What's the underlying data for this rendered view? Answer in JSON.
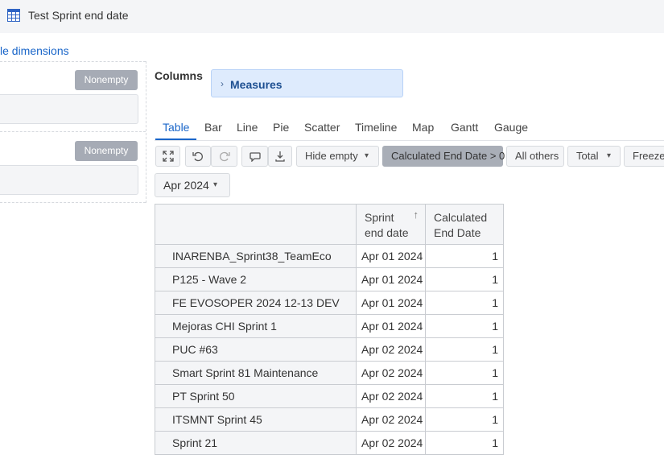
{
  "window": {
    "title": "Test Sprint end date",
    "icon": "table-icon"
  },
  "dimensions_link": "le dimensions",
  "filters": {
    "rows_nonempty": "Nonempty",
    "pages_nonempty": "Nonempty"
  },
  "columns": {
    "label": "Columns",
    "measure_chip": "Measures"
  },
  "tabs": [
    {
      "label": "Table",
      "active": true
    },
    {
      "label": "Bar"
    },
    {
      "label": "Line"
    },
    {
      "label": "Pie"
    },
    {
      "label": "Scatter"
    },
    {
      "label": "Timeline"
    },
    {
      "label": "Map"
    },
    {
      "label": "Gantt"
    },
    {
      "label": "Gauge"
    }
  ],
  "toolbar": {
    "icons": [
      "fullscreen-icon",
      "undo-icon",
      "redo-icon",
      "comment-icon",
      "export-icon"
    ],
    "hide_empty": "Hide empty",
    "filter_chip": "Calculated End Date > 0",
    "all_others": "All others",
    "total": "Total",
    "freeze": "Freeze"
  },
  "page_filter": {
    "value": "Apr 2024"
  },
  "table": {
    "headers": {
      "col1_line1": "Sprint",
      "col1_line2": "end date",
      "col2_line1": "Calculated",
      "col2_line2": "End Date"
    },
    "rows": [
      {
        "name": "INARENBA_Sprint38_TeamEco",
        "date": "Apr 01 2024",
        "value": "1"
      },
      {
        "name": "P125 - Wave 2",
        "date": "Apr 01 2024",
        "value": "1"
      },
      {
        "name": "FE EVOSOPER 2024 12-13 DEV",
        "date": "Apr 01 2024",
        "value": "1"
      },
      {
        "name": "Mejoras CHI Sprint 1",
        "date": "Apr 01 2024",
        "value": "1"
      },
      {
        "name": "PUC #63",
        "date": "Apr 02 2024",
        "value": "1"
      },
      {
        "name": "Smart Sprint 81 Maintenance",
        "date": "Apr 02 2024",
        "value": "1"
      },
      {
        "name": "PT Sprint 50",
        "date": "Apr 02 2024",
        "value": "1"
      },
      {
        "name": "ITSMNT Sprint 45",
        "date": "Apr 02 2024",
        "value": "1"
      },
      {
        "name": "Sprint 21",
        "date": "Apr 02 2024",
        "value": "1"
      }
    ]
  },
  "colors": {
    "accent": "#1a66c9",
    "chip_bg": "#deebfd",
    "toolbar_bg": "#f4f5f7"
  }
}
